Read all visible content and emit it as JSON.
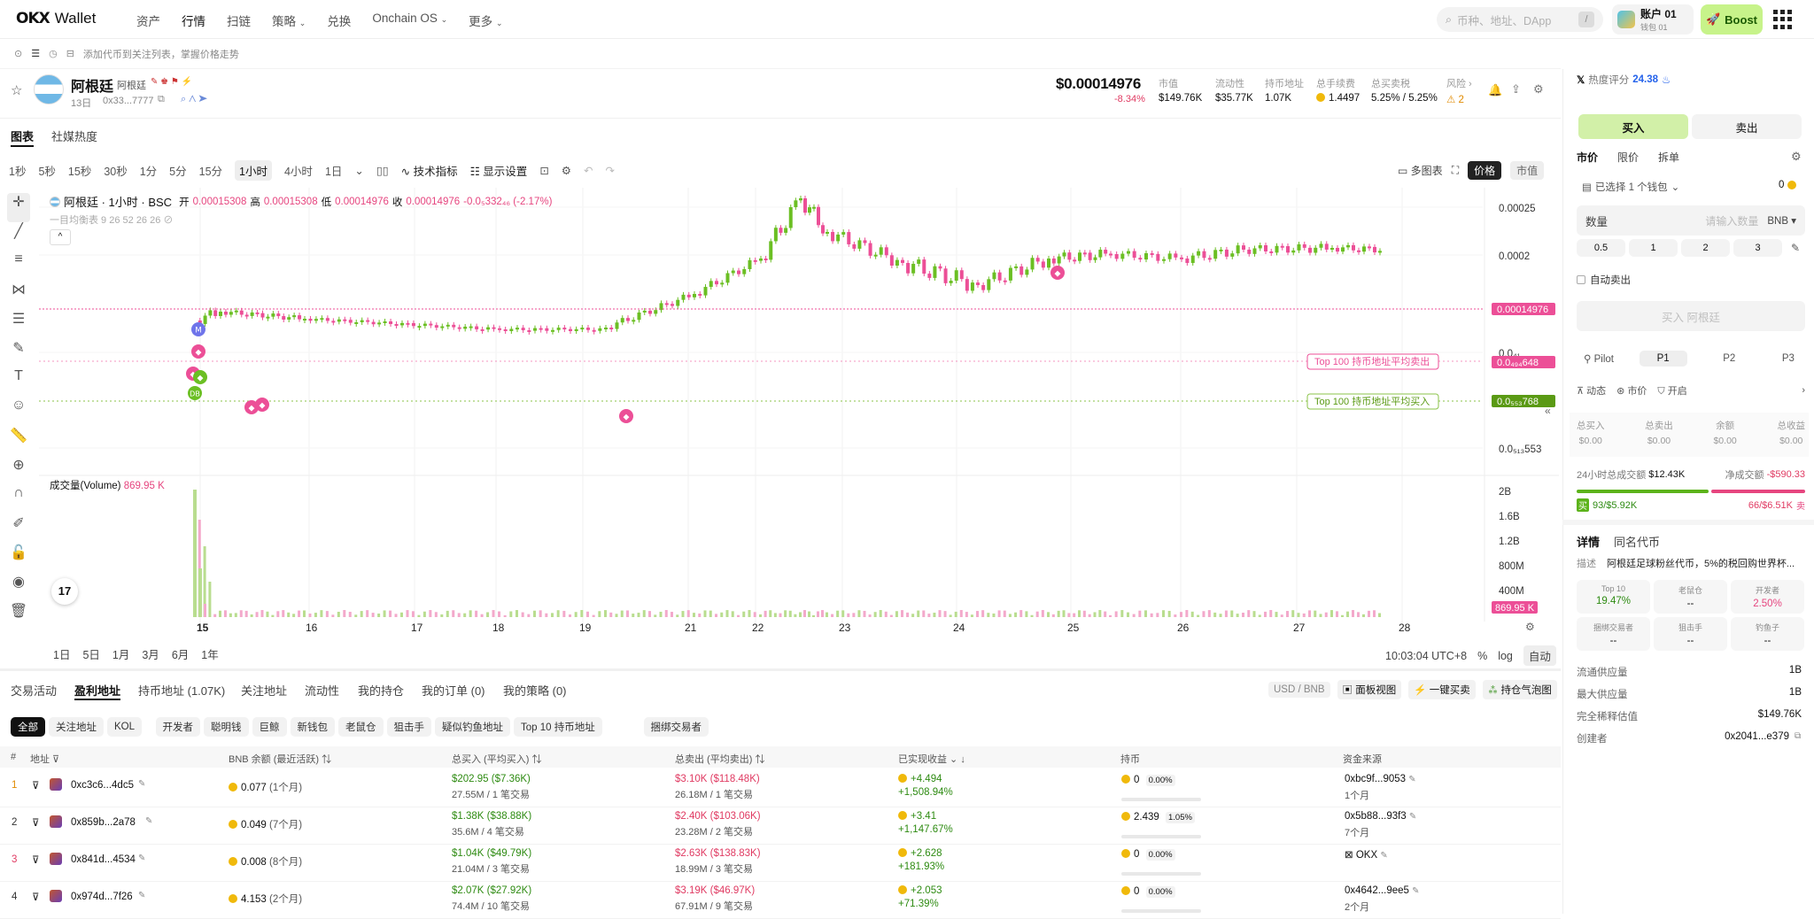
{
  "nav": {
    "logo_mark": "OKX",
    "logo_text": "Wallet",
    "items": [
      "资产",
      "行情",
      "扫链",
      "策略",
      "兑换",
      "Onchain OS",
      "更多"
    ],
    "search_placeholder": "币种、地址、DApp",
    "search_shortcut": "/",
    "account_name": "账户 01",
    "account_sub": "钱包 01",
    "boost": "Boost"
  },
  "subbar": {
    "hint": "添加代币到关注列表，掌握价格走势"
  },
  "token": {
    "name": "阿根廷",
    "subname": "阿根廷",
    "age": "13日",
    "address": "0x33...7777",
    "price": "$0.00014976",
    "change": "-8.34%",
    "metrics": [
      {
        "label": "市值",
        "value": "$149.76K"
      },
      {
        "label": "流动性",
        "value": "$35.77K"
      },
      {
        "label": "持币地址",
        "value": "1.07K"
      },
      {
        "label": "总手续费",
        "value": "1.4497"
      },
      {
        "label": "总买卖税",
        "value": "5.25% / 5.25%"
      },
      {
        "label": "风险",
        "value": "2"
      }
    ]
  },
  "chart_tabs": [
    "图表",
    "社媒热度"
  ],
  "timeframes": [
    "1秒",
    "5秒",
    "15秒",
    "30秒",
    "1分",
    "5分",
    "15分",
    "1小时",
    "4小时",
    "1日"
  ],
  "toolbar": {
    "indicators": "技术指标",
    "display": "显示设置",
    "multi": "多图表",
    "price_btn": "价格",
    "mcap_btn": "市值"
  },
  "chart_legend": {
    "title": "阿根廷 · 1小时 · BSC",
    "open_label": "开",
    "open": "0.00015308",
    "high_label": "高",
    "high": "0.00015308",
    "low_label": "低",
    "low": "0.00014976",
    "close_label": "收",
    "close": "0.00014976",
    "delta": "-0.0₅332₄₆ (-2.17%)",
    "ma_line": "一目均衡表 9 26 52 26 26",
    "volume_label": "成交量(Volume)",
    "volume_value": "869.95 K"
  },
  "chart_data": {
    "type": "candlestick",
    "x_ticks": [
      "15",
      "16",
      "17",
      "18",
      "19",
      "21",
      "22",
      "23",
      "24",
      "25",
      "26",
      "27",
      "28"
    ],
    "y_ticks": [
      "0.00025",
      "0.0002",
      "0.0₄₁",
      "0.0₅₁₃553"
    ],
    "current_price_label": "0.00014976",
    "avg_sell_label": "0.0₄₉₄648",
    "avg_sell_text": "Top 100 持币地址平均卖出",
    "avg_buy_label": "0.0₅₅₃768",
    "avg_buy_text": "Top 100 持币地址平均买入",
    "volume_ticks": [
      "2B",
      "1.6B",
      "1.2B",
      "800M",
      "400M"
    ],
    "volume_current": "869.95 K"
  },
  "range_btns": [
    "1日",
    "5日",
    "1月",
    "3月",
    "6月",
    "1年"
  ],
  "chart_footer": {
    "time": "10:03:04 UTC+8",
    "pct": "%",
    "log": "log",
    "auto": "自动"
  },
  "bottom_tabs": [
    "交易活动",
    "盈利地址",
    "持币地址 (1.07K)",
    "关注地址",
    "流动性",
    "我的持仓",
    "我的订单 (0)",
    "我的策略 (0)"
  ],
  "bottom_right": {
    "unit": "USD / BNB",
    "board": "面板视图",
    "onekey": "一键买卖",
    "bubble": "持仓气泡图"
  },
  "filters": [
    "全部",
    "关注地址",
    "KOL",
    "开发者",
    "聪明钱",
    "巨鲸",
    "新钱包",
    "老鼠仓",
    "狙击手",
    "疑似钓鱼地址",
    "Top 10 持币地址",
    "捆绑交易者"
  ],
  "table": {
    "headers": [
      "#",
      "地址",
      "BNB 余额 (最近活跃)",
      "总买入 (平均买入)",
      "总卖出 (平均卖出)",
      "已实现收益",
      "持币",
      "资金来源"
    ],
    "rows": [
      {
        "n": "1",
        "addr": "0xc3c6...4dc5",
        "bal": "0.077",
        "bal_t": "(1个月)",
        "buy": "$202.95",
        "buy_avg": "($7.36K)",
        "buy_sub": "27.55M / 1 笔交易",
        "sell": "$3.10K",
        "sell_avg": "($118.48K)",
        "sell_sub": "26.18M / 1 笔交易",
        "pnl": "+4.494",
        "pnl_pct": "+1,508.94%",
        "hold": "0",
        "hold_pct": "0.00%",
        "src": "0xbc9f...9053",
        "src_t": "1个月"
      },
      {
        "n": "2",
        "addr": "0x859b...2a78",
        "bal": "0.049",
        "bal_t": "(7个月)",
        "buy": "$1.38K",
        "buy_avg": "($38.88K)",
        "buy_sub": "35.6M / 4 笔交易",
        "sell": "$2.40K",
        "sell_avg": "($103.06K)",
        "sell_sub": "23.28M / 2 笔交易",
        "pnl": "+3.41",
        "pnl_pct": "+1,147.67%",
        "hold": "2.439",
        "hold_pct": "1.05%",
        "src": "0x5b88...93f3",
        "src_t": "7个月"
      },
      {
        "n": "3",
        "addr": "0x841d...4534",
        "bal": "0.008",
        "bal_t": "(8个月)",
        "buy": "$1.04K",
        "buy_avg": "($49.79K)",
        "buy_sub": "21.04M / 3 笔交易",
        "sell": "$2.63K",
        "sell_avg": "($138.83K)",
        "sell_sub": "18.99M / 3 笔交易",
        "pnl": "+2.628",
        "pnl_pct": "+181.93%",
        "hold": "0",
        "hold_pct": "0.00%",
        "src": "OKX",
        "src_t": ""
      },
      {
        "n": "4",
        "addr": "0x974d...7f26",
        "bal": "4.153",
        "bal_t": "(2个月)",
        "buy": "$2.07K",
        "buy_avg": "($27.92K)",
        "buy_sub": "74.4M / 10 笔交易",
        "sell": "$3.19K",
        "sell_avg": "($46.97K)",
        "sell_sub": "67.91M / 9 笔交易",
        "pnl": "+2.053",
        "pnl_pct": "+71.39%",
        "hold": "0",
        "hold_pct": "0.00%",
        "src": "0x4642...9ee5",
        "src_t": "2个月"
      }
    ]
  },
  "panel": {
    "heat_label": "热度评分",
    "heat": "24.38",
    "buy": "买入",
    "sell": "卖出",
    "order_tabs": [
      "市价",
      "限价",
      "拆单"
    ],
    "wallet_sel": "已选择 1 个钱包",
    "wallet_bal": "0",
    "qty_label": "数量",
    "qty_placeholder": "请输入数量",
    "qty_unit": "BNB",
    "presets": [
      "0.5",
      "1",
      "2",
      "3"
    ],
    "auto_sell": "自动卖出",
    "submit": "买入 阿根廷",
    "modes": [
      "Pilot",
      "P1",
      "P2",
      "P3"
    ],
    "dyn": "动态",
    "mkt": "市价",
    "on": "开启",
    "stats": [
      {
        "l": "总买入",
        "v": "$0.00"
      },
      {
        "l": "总卖出",
        "v": "$0.00"
      },
      {
        "l": "余额",
        "v": "$0.00"
      },
      {
        "l": "总收益",
        "v": "$0.00"
      }
    ],
    "vol24_label": "24小时总成交额",
    "vol24": "$12.43K",
    "net_label": "净成交额",
    "net": "-$590.33",
    "buy_side": "93/$5.92K",
    "sell_side": "66/$6.51K",
    "buy_tag": "买",
    "sell_tag": "卖",
    "detail_tabs": [
      "详情",
      "同名代币"
    ],
    "desc_label": "描述",
    "desc": "阿根廷足球粉丝代币，5%的税回购世界杯...",
    "badges": [
      {
        "l": "Top 10",
        "v": "19.47%"
      },
      {
        "l": "老鼠仓",
        "v": "--"
      },
      {
        "l": "开发者",
        "v": "2.50%"
      },
      {
        "l": "捆绑交易者",
        "v": "--"
      },
      {
        "l": "狙击手",
        "v": "--"
      },
      {
        "l": "钓鱼子",
        "v": "--"
      }
    ],
    "supply": [
      {
        "l": "流通供应量",
        "v": "1B"
      },
      {
        "l": "最大供应量",
        "v": "1B"
      },
      {
        "l": "完全稀释估值",
        "v": "$149.76K"
      },
      {
        "l": "创建者",
        "v": "0x2041...e379"
      }
    ]
  }
}
